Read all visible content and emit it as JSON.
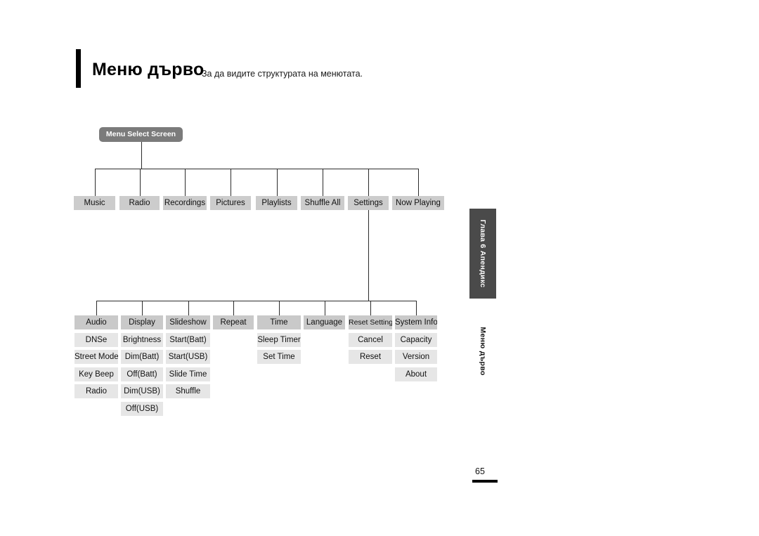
{
  "page": {
    "title": "Меню дърво",
    "subtitle": "За да видите структурата на менютата.",
    "number": "65",
    "colors": {
      "root_box": "#7b7b7b",
      "level1_box": "#cccccc",
      "group_head_box": "#c9c9c9",
      "leaf_box": "#e6e6e6",
      "connector_line": "#2b2b2b",
      "side_tab": "#4a4a4a",
      "accent_bar": "#000000"
    }
  },
  "side_tab": {
    "chapter": "Глава 6   Апендикс",
    "section": "Меню дърво"
  },
  "tree": {
    "root": "Menu Select Screen",
    "level1": [
      "Music",
      "Radio",
      "Recordings",
      "Pictures",
      "Playlists",
      "Shuffle All",
      "Settings",
      "Now Playing"
    ],
    "settings_groups": [
      {
        "head": "Audio",
        "items": [
          "DNSe",
          "Street Mode",
          "Key Beep",
          "Radio"
        ]
      },
      {
        "head": "Display",
        "items": [
          "Brightness",
          "Dim(Batt)",
          "Off(Batt)",
          "Dim(USB)",
          "Off(USB)"
        ]
      },
      {
        "head": "Slideshow",
        "items": [
          "Start(Batt)",
          "Start(USB)",
          "Slide Time",
          "Shuffle"
        ]
      },
      {
        "head": "Repeat",
        "items": []
      },
      {
        "head": "Time",
        "items": [
          "Sleep Timer",
          "Set Time"
        ]
      },
      {
        "head": "Language",
        "items": []
      },
      {
        "head": "Reset Settings",
        "items": [
          "Cancel",
          "Reset"
        ]
      },
      {
        "head": "System Info",
        "items": [
          "Capacity",
          "Version",
          "About"
        ]
      }
    ]
  }
}
